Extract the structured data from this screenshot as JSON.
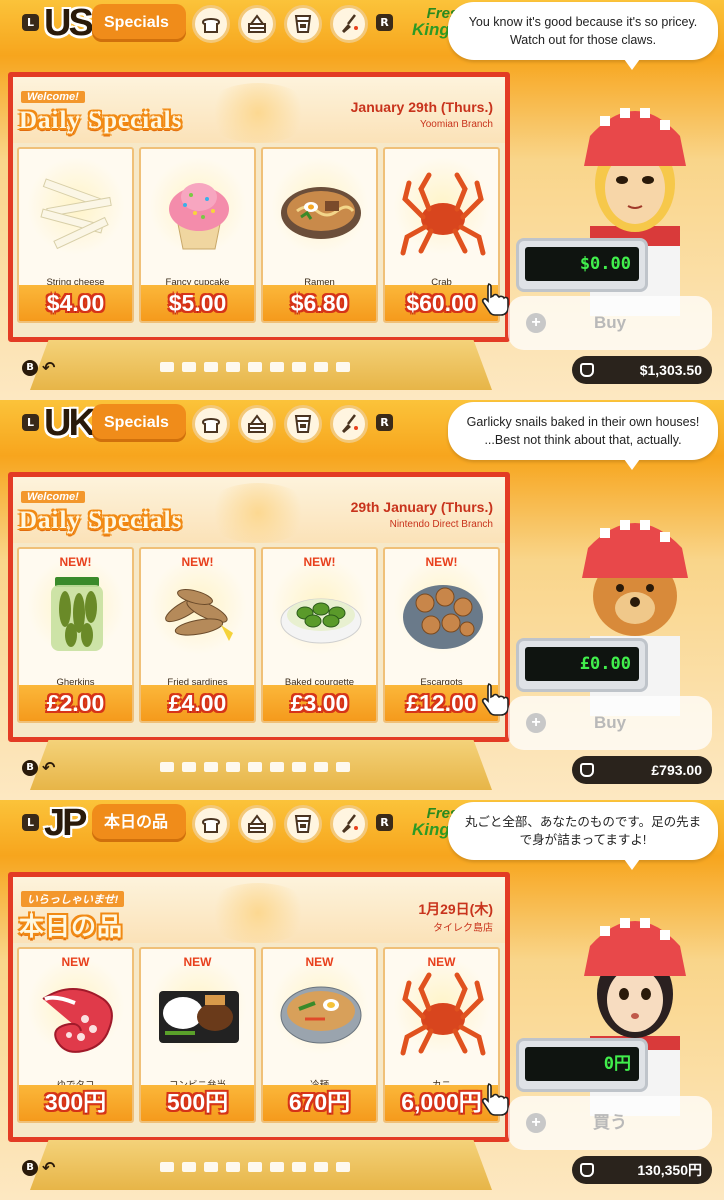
{
  "panels": [
    {
      "region": "US",
      "tab_label": "Specials",
      "logo": {
        "line1": "Fresh",
        "line2": "Kingdom"
      },
      "dialogue": "You know it's good because it's so pricey. Watch out for those claws.",
      "board": {
        "welcome": "Welcome!",
        "title": "Daily Specials",
        "date": "January 29th (Thurs.)",
        "branch": "Yoomian Branch"
      },
      "items": [
        {
          "new_tag": "",
          "name": "String cheese",
          "price": "$4.00",
          "icon": "string-cheese-icon"
        },
        {
          "new_tag": "",
          "name": "Fancy cupcake",
          "price": "$5.00",
          "icon": "cupcake-icon"
        },
        {
          "new_tag": "",
          "name": "Ramen",
          "price": "$6.80",
          "icon": "ramen-icon"
        },
        {
          "new_tag": "",
          "name": "Crab",
          "price": "$60.00",
          "icon": "crab-icon"
        }
      ],
      "register_amount": "$0.00",
      "buy_label": "Buy",
      "wallet": "$1,303.50",
      "back_key": "B"
    },
    {
      "region": "UK",
      "tab_label": "Specials",
      "logo": {
        "line1": "",
        "line2": ""
      },
      "dialogue": "Garlicky snails baked in their own houses! ...Best not think about that, actually.",
      "board": {
        "welcome": "Welcome!",
        "title": "Daily Specials",
        "date": "29th January (Thurs.)",
        "branch": "Nintendo Direct Branch"
      },
      "items": [
        {
          "new_tag": "NEW!",
          "name": "Gherkins",
          "price": "£2.00",
          "icon": "gherkin-jar-icon"
        },
        {
          "new_tag": "NEW!",
          "name": "Fried sardines",
          "price": "£4.00",
          "icon": "fried-sardines-icon"
        },
        {
          "new_tag": "NEW!",
          "name": "Baked courgette",
          "price": "£3.00",
          "icon": "baked-courgette-icon"
        },
        {
          "new_tag": "NEW!",
          "name": "Escargots",
          "price": "£12.00",
          "icon": "escargots-icon"
        }
      ],
      "register_amount": "£0.00",
      "buy_label": "Buy",
      "wallet": "£793.00",
      "back_key": "B"
    },
    {
      "region": "JP",
      "tab_label": "本日の品",
      "logo": {
        "line1": "Fresh",
        "line2": "Kingdom"
      },
      "dialogue": "丸ごと全部、あなたのものです。足の先まで身が詰まってますよ!",
      "board": {
        "welcome": "いらっしゃいませ!",
        "title": "本日の品",
        "date": "1月29日(木)",
        "branch": "タイレク島店"
      },
      "items": [
        {
          "new_tag": "NEW",
          "name": "ゆでタコ",
          "price": "300円",
          "icon": "octopus-icon"
        },
        {
          "new_tag": "NEW",
          "name": "コンビニ弁当",
          "price": "500円",
          "icon": "bento-icon"
        },
        {
          "new_tag": "NEW",
          "name": "冷麺",
          "price": "670円",
          "icon": "cold-noodles-icon"
        },
        {
          "new_tag": "NEW",
          "name": "カニ",
          "price": "6,000円",
          "icon": "crab-icon"
        }
      ],
      "register_amount": "0円",
      "buy_label": "買う",
      "wallet": "130,350円",
      "back_key": "B"
    }
  ],
  "controls": {
    "l_key": "L",
    "r_key": "R"
  },
  "colors": {
    "board_border": "#e33b24",
    "price_orange": "#f59a1c",
    "register_green": "#41ee4c"
  }
}
